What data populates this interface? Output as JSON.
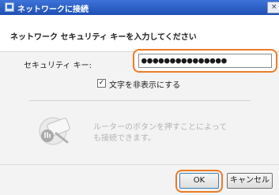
{
  "window": {
    "title": "ネットワークに接続",
    "close_glyph": "×"
  },
  "header": {
    "heading": "ネットワーク セキュリティ キーを入力してください"
  },
  "security_key": {
    "label": "セキュリティ キー:",
    "value": "●●●●●●●●●●●●●●●"
  },
  "hide_chars": {
    "label": "文字を非表示にする",
    "checked": true,
    "check_glyph": "✓"
  },
  "wps": {
    "text_line1": "ルーターのボタンを押すことによって",
    "text_line2": "も接続できます。",
    "icon": "wps-router-icon"
  },
  "buttons": {
    "ok": "OK",
    "cancel": "キャンセル"
  },
  "colors": {
    "titlebar": "#2a5fc8",
    "highlight": "#ec7b27"
  }
}
